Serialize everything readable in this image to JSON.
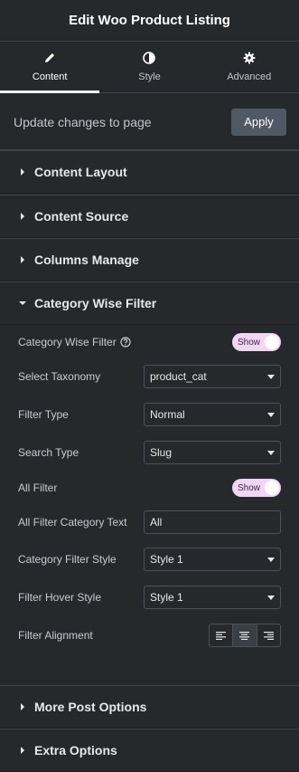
{
  "header": {
    "title": "Edit Woo Product Listing"
  },
  "tabs": [
    {
      "label": "Content",
      "icon": "pencil-icon",
      "active": true
    },
    {
      "label": "Style",
      "icon": "contrast-icon",
      "active": false
    },
    {
      "label": "Advanced",
      "icon": "gear-icon",
      "active": false
    }
  ],
  "update": {
    "text": "Update changes to page",
    "apply_label": "Apply"
  },
  "sections": {
    "content_layout": "Content Layout",
    "content_source": "Content Source",
    "columns_manage": "Columns Manage",
    "category_wise_filter": "Category Wise Filter",
    "more_post_options": "More Post Options",
    "extra_options": "Extra Options"
  },
  "controls": {
    "category_wise_filter": {
      "label": "Category Wise Filter",
      "toggle": "Show"
    },
    "select_taxonomy": {
      "label": "Select Taxonomy",
      "value": "product_cat"
    },
    "filter_type": {
      "label": "Filter Type",
      "value": "Normal"
    },
    "search_type": {
      "label": "Search Type",
      "value": "Slug"
    },
    "all_filter": {
      "label": "All Filter",
      "toggle": "Show"
    },
    "all_filter_category_text": {
      "label": "All Filter Category Text",
      "value": "All"
    },
    "category_filter_style": {
      "label": "Category Filter Style",
      "value": "Style 1"
    },
    "filter_hover_style": {
      "label": "Filter Hover Style",
      "value": "Style 1"
    },
    "filter_alignment": {
      "label": "Filter Alignment",
      "options": [
        "align-left-icon",
        "align-center-icon",
        "align-right-icon"
      ],
      "selected": "align-center-icon"
    }
  },
  "colors": {
    "background": "#26292c",
    "toggle": "#f1d6f6",
    "button": "#505863"
  }
}
